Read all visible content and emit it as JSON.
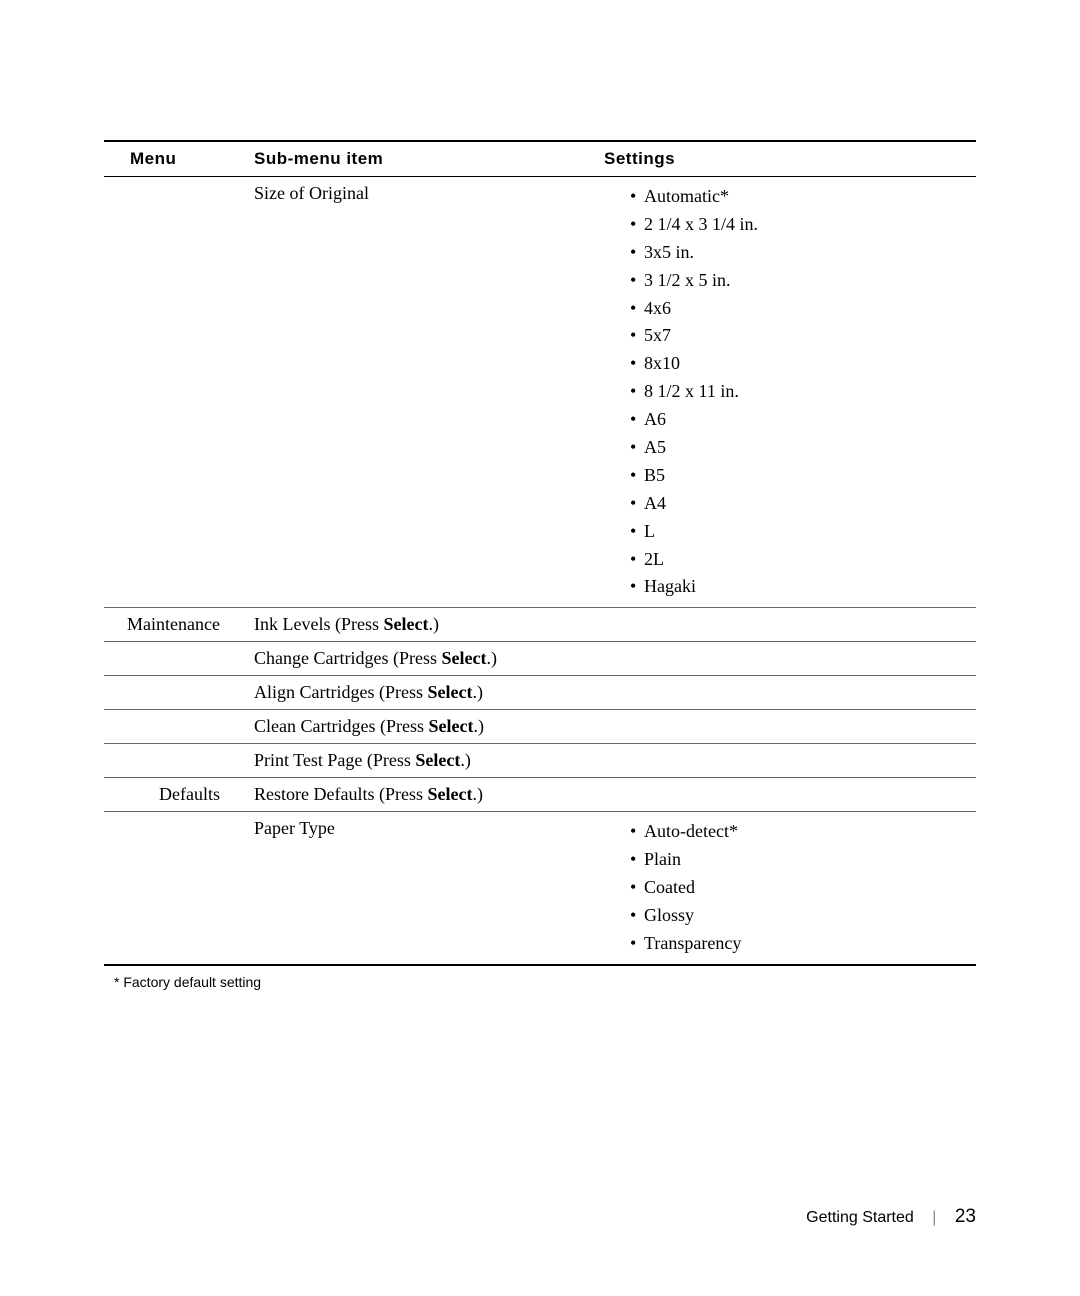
{
  "headers": {
    "menu": "Menu",
    "sub": "Sub-menu item",
    "settings": "Settings"
  },
  "size_of_original": {
    "label": "Size of Original",
    "options": [
      "Automatic*",
      "2 1/4 x 3 1/4 in.",
      "3x5 in.",
      "3 1/2 x 5 in.",
      "4x6",
      "5x7",
      "8x10",
      "8 1/2 x 11 in.",
      "A6",
      "A5",
      "B5",
      "A4",
      "L",
      "2L",
      "Hagaki"
    ]
  },
  "maintenance": {
    "label": "Maintenance",
    "items": {
      "ink": {
        "pre": "Ink Levels (Press ",
        "bold": "Select",
        "post": ".)"
      },
      "change": {
        "pre": "Change Cartridges (Press ",
        "bold": "Select",
        "post": ".)"
      },
      "align": {
        "pre": "Align Cartridges (Press ",
        "bold": "Select",
        "post": ".)"
      },
      "clean": {
        "pre": "Clean Cartridges (Press ",
        "bold": "Select",
        "post": ".)"
      },
      "test": {
        "pre": "Print Test Page (Press ",
        "bold": "Select",
        "post": ".)"
      }
    }
  },
  "defaults": {
    "label": "Defaults",
    "restore": {
      "pre": "Restore Defaults (Press ",
      "bold": "Select",
      "post": ".)"
    },
    "paper_type": {
      "label": "Paper Type",
      "options": [
        "Auto-detect*",
        "Plain",
        "Coated",
        "Glossy",
        "Transparency"
      ]
    }
  },
  "footnote": "* Factory default setting",
  "footer": {
    "section": "Getting Started",
    "page": "23"
  }
}
